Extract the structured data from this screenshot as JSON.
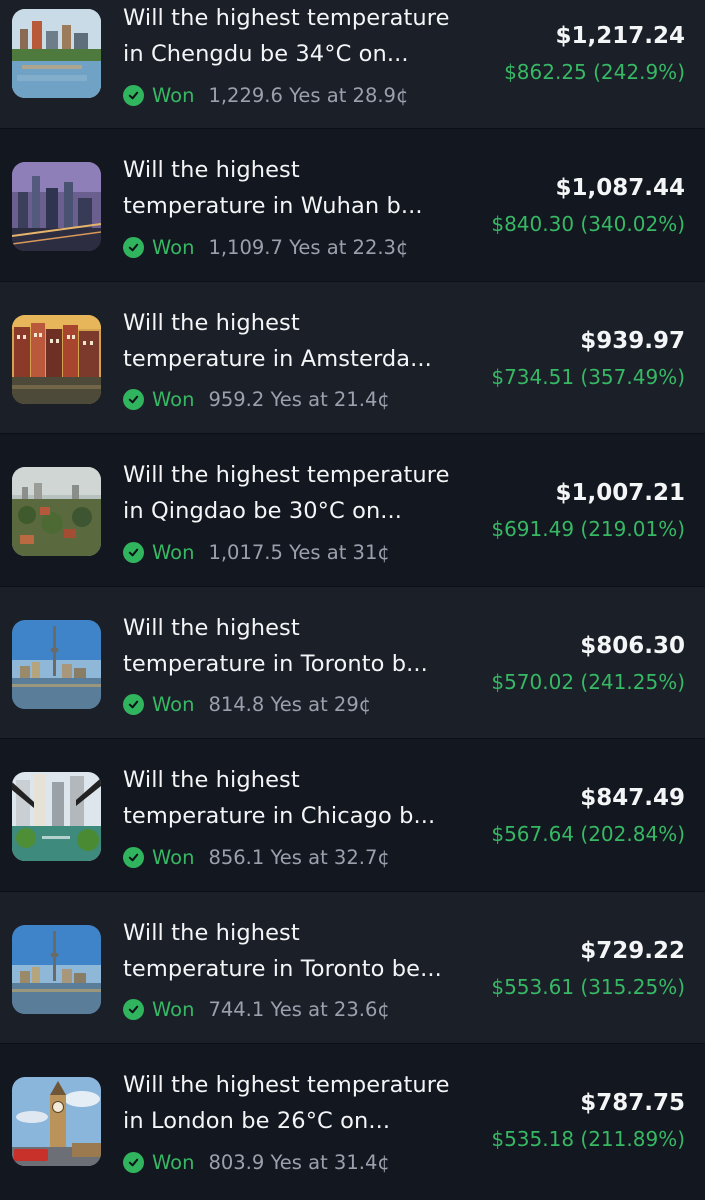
{
  "positions": [
    {
      "title_line1": "Will the highest temperature",
      "title_line2": "in Chengdu be 34°C on...",
      "status": "Won",
      "shares": "1,229.6 Yes at 28.9¢",
      "value": "$1,217.24",
      "pnl": "$862.25 (242.9%)",
      "icon": "chengdu-city-image"
    },
    {
      "title_line1": "Will the highest",
      "title_line2": "temperature in Wuhan b...",
      "status": "Won",
      "shares": "1,109.7 Yes at 22.3¢",
      "value": "$1,087.44",
      "pnl": "$840.30 (340.02%)",
      "icon": "wuhan-city-image"
    },
    {
      "title_line1": "Will the highest",
      "title_line2": "temperature in Amsterda...",
      "status": "Won",
      "shares": "959.2 Yes at 21.4¢",
      "value": "$939.97",
      "pnl": "$734.51 (357.49%)",
      "icon": "amsterdam-canal-houses-image"
    },
    {
      "title_line1": "Will the highest temperature",
      "title_line2": "in Qingdao be 30°C on...",
      "status": "Won",
      "shares": "1,017.5 Yes at 31¢",
      "value": "$1,007.21",
      "pnl": "$691.49 (219.01%)",
      "icon": "qingdao-city-image"
    },
    {
      "title_line1": "Will the highest",
      "title_line2": "temperature in Toronto b...",
      "status": "Won",
      "shares": "814.8 Yes at 29¢",
      "value": "$806.30",
      "pnl": "$570.02 (241.25%)",
      "icon": "toronto-skyline-image"
    },
    {
      "title_line1": "Will the highest",
      "title_line2": "temperature in Chicago b...",
      "status": "Won",
      "shares": "856.1 Yes at 32.7¢",
      "value": "$847.49",
      "pnl": "$567.64 (202.84%)",
      "icon": "chicago-river-image"
    },
    {
      "title_line1": "Will the highest",
      "title_line2": "temperature in Toronto be...",
      "status": "Won",
      "shares": "744.1 Yes at 23.6¢",
      "value": "$729.22",
      "pnl": "$553.61 (315.25%)",
      "icon": "toronto-skyline-image"
    },
    {
      "title_line1": "Will the highest temperature",
      "title_line2": "in London be 26°C on...",
      "status": "Won",
      "shares": "803.9 Yes at 31.4¢",
      "value": "$787.75",
      "pnl": "$535.18 (211.89%)",
      "icon": "london-big-ben-image"
    }
  ],
  "colors": {
    "background": "#13171f",
    "row_alt": "#1b1f28",
    "won_green": "#36b864",
    "text_primary": "#f4f5f7",
    "text_secondary": "#9aa1ad"
  }
}
